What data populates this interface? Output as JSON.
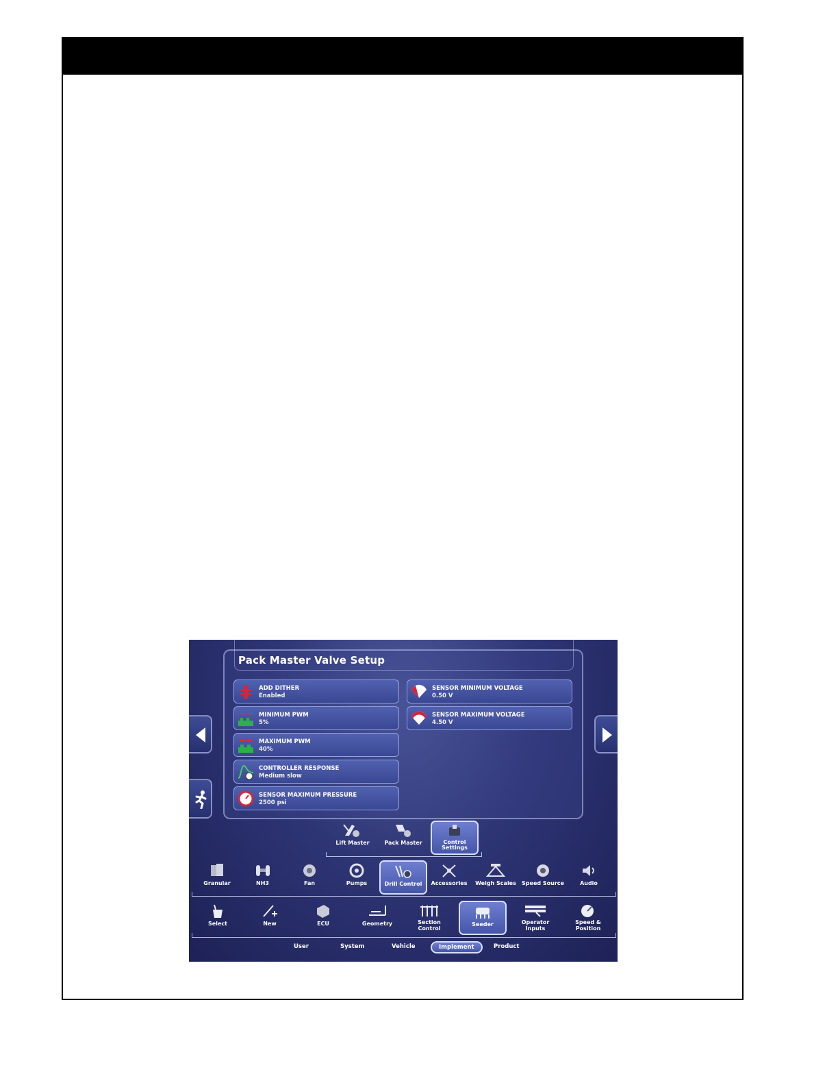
{
  "screen": {
    "title": "Pack Master Valve Setup",
    "settings_left": [
      {
        "label": "ADD DITHER",
        "value": "Enabled",
        "icon": "dither-icon"
      },
      {
        "label": "MINIMUM PWM",
        "value": "5%",
        "icon": "min-pwm-icon"
      },
      {
        "label": "MAXIMUM PWM",
        "value": "40%",
        "icon": "max-pwm-icon"
      },
      {
        "label": "CONTROLLER RESPONSE",
        "value": "Medium slow",
        "icon": "controller-response-icon"
      },
      {
        "label": "SENSOR MAXIMUM PRESSURE",
        "value": "2500 psi",
        "icon": "pressure-gauge-icon"
      }
    ],
    "settings_right": [
      {
        "label": "SENSOR MINIMUM VOLTAGE",
        "value": "0.50 V",
        "icon": "min-voltage-icon"
      },
      {
        "label": "SENSOR MAXIMUM VOLTAGE",
        "value": "4.50 V",
        "icon": "max-voltage-icon"
      }
    ],
    "tier1": [
      {
        "label": "Lift Master"
      },
      {
        "label": "Pack Master"
      },
      {
        "label": "Control Settings",
        "selected": true
      }
    ],
    "tier2": [
      {
        "label": "Granular"
      },
      {
        "label": "NH3"
      },
      {
        "label": "Fan"
      },
      {
        "label": "Pumps"
      },
      {
        "label": "Drill Control",
        "selected": true
      },
      {
        "label": "Accessories"
      },
      {
        "label": "Weigh Scales"
      },
      {
        "label": "Speed Source"
      },
      {
        "label": "Audio"
      }
    ],
    "tier3": [
      {
        "label": "Select"
      },
      {
        "label": "New"
      },
      {
        "label": "ECU"
      },
      {
        "label": "Geometry"
      },
      {
        "label": "Section Control"
      },
      {
        "label": "Seeder",
        "selected": true
      },
      {
        "label": "Operator Inputs"
      },
      {
        "label": "Speed & Position"
      }
    ],
    "bottom_tabs": [
      {
        "label": "User"
      },
      {
        "label": "System"
      },
      {
        "label": "Vehicle"
      },
      {
        "label": "Implement",
        "selected": true
      },
      {
        "label": "Product"
      }
    ]
  }
}
